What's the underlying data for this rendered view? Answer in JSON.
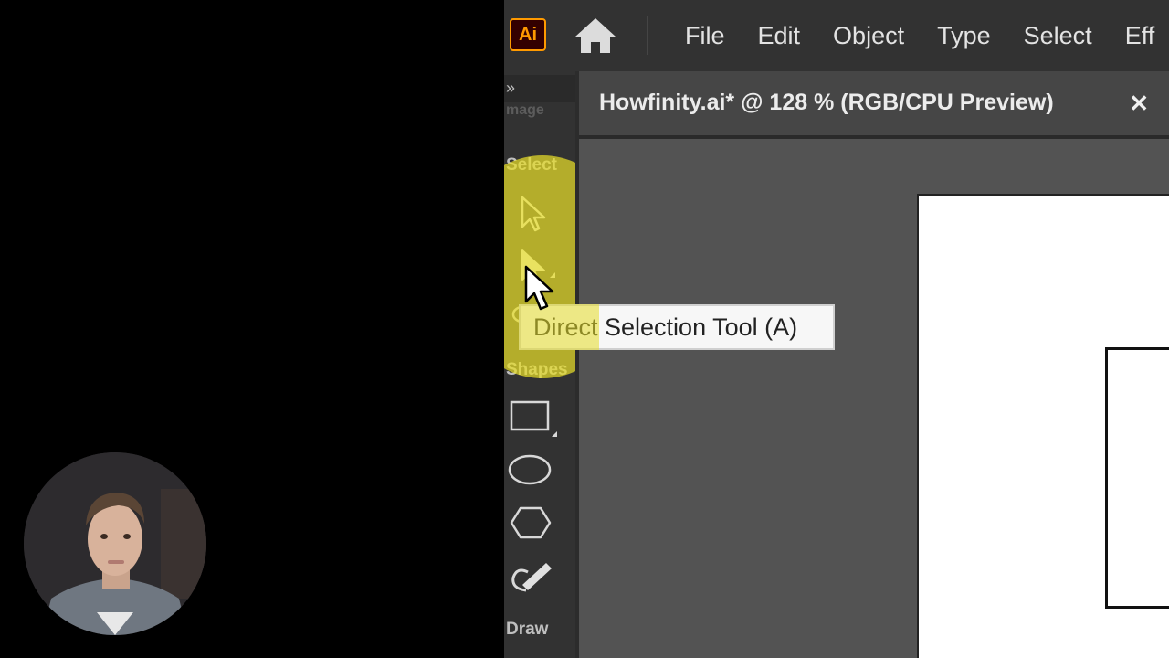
{
  "app": {
    "logo_text": "Ai",
    "accent_color": "#ff9a00"
  },
  "menu": {
    "items": [
      "File",
      "Edit",
      "Object",
      "Type",
      "Select",
      "Eff"
    ]
  },
  "document": {
    "tab_title": "Howfinity.ai* @ 128 % (RGB/CPU Preview)",
    "close_glyph": "✕"
  },
  "toolbar": {
    "chevron": "»",
    "header_label": "mage",
    "section_select": "Select",
    "section_shapes": "Shapes",
    "section_draw": "Draw",
    "tools": [
      "selection-tool",
      "direct-selection-tool",
      "rectangle-tool",
      "ellipse-tool",
      "polygon-tool",
      "shaper-tool"
    ]
  },
  "tooltip": {
    "text": "Direct Selection Tool (A)"
  },
  "colors": {
    "highlight": "#e6dc28",
    "menubar": "#323232",
    "canvas": "#535353"
  }
}
